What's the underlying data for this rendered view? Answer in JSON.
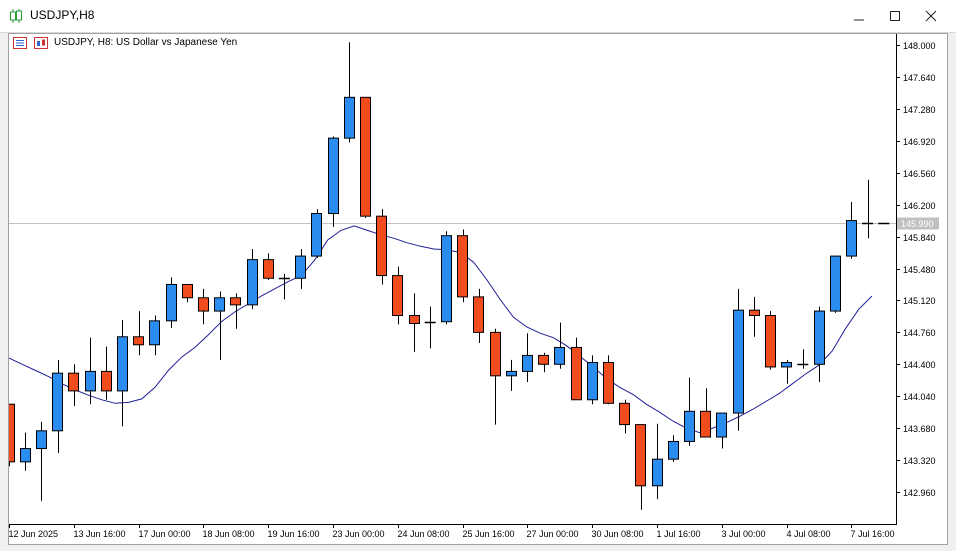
{
  "window": {
    "title": "USDJPY,H8",
    "minimize_icon": "minimize-icon",
    "maximize_icon": "maximize-icon",
    "close_icon": "close-icon"
  },
  "chart_header": {
    "text": "USDJPY, H8:  US Dollar vs Japanese Yen"
  },
  "colors": {
    "bull": "#2b8cf0",
    "bear": "#f04c1e",
    "wick": "#000000",
    "ma": "#1e1e96",
    "grid_line": "#c0c0c0",
    "price_tag_bg": "#c0c0c0"
  },
  "chart_data": {
    "type": "candlestick",
    "symbol": "USDJPY",
    "timeframe": "H8",
    "ylim": [
      142.7,
      148.15
    ],
    "yticks": [
      "148.000",
      "147.640",
      "147.280",
      "146.920",
      "146.560",
      "146.200",
      "145.840",
      "145.480",
      "145.120",
      "144.760",
      "144.400",
      "144.040",
      "143.680",
      "143.320",
      "142.960"
    ],
    "xticks": [
      {
        "label": "12 Jun 2025",
        "index": 0
      },
      {
        "label": "13 Jun 16:00",
        "index": 4
      },
      {
        "label": "17 Jun 00:00",
        "index": 8
      },
      {
        "label": "18 Jun 08:00",
        "index": 12
      },
      {
        "label": "19 Jun 16:00",
        "index": 16
      },
      {
        "label": "23 Jun 00:00",
        "index": 20
      },
      {
        "label": "24 Jun 08:00",
        "index": 24
      },
      {
        "label": "25 Jun 16:00",
        "index": 28
      },
      {
        "label": "27 Jun 00:00",
        "index": 32
      },
      {
        "label": "30 Jun 08:00",
        "index": 36
      },
      {
        "label": "1 Jul 16:00",
        "index": 40
      },
      {
        "label": "3 Jul 00:00",
        "index": 44
      },
      {
        "label": "4 Jul 08:00",
        "index": 48
      },
      {
        "label": "7 Jul 16:00",
        "index": 52
      }
    ],
    "current_price": "145.990",
    "candles": [
      {
        "o": 143.95,
        "h": 143.95,
        "l": 143.25,
        "c": 143.3
      },
      {
        "o": 143.3,
        "h": 143.63,
        "l": 143.2,
        "c": 143.45
      },
      {
        "o": 143.45,
        "h": 143.75,
        "l": 142.86,
        "c": 143.65
      },
      {
        "o": 143.65,
        "h": 144.45,
        "l": 143.4,
        "c": 144.3
      },
      {
        "o": 144.3,
        "h": 144.4,
        "l": 143.93,
        "c": 144.1
      },
      {
        "o": 144.1,
        "h": 144.7,
        "l": 143.95,
        "c": 144.32
      },
      {
        "o": 144.32,
        "h": 144.6,
        "l": 144.0,
        "c": 144.1
      },
      {
        "o": 144.1,
        "h": 144.9,
        "l": 143.7,
        "c": 144.71
      },
      {
        "o": 144.71,
        "h": 145.0,
        "l": 144.5,
        "c": 144.62
      },
      {
        "o": 144.62,
        "h": 144.95,
        "l": 144.5,
        "c": 144.89
      },
      {
        "o": 144.89,
        "h": 145.38,
        "l": 144.81,
        "c": 145.3
      },
      {
        "o": 145.3,
        "h": 145.3,
        "l": 145.1,
        "c": 145.15
      },
      {
        "o": 145.15,
        "h": 145.25,
        "l": 144.85,
        "c": 145.0
      },
      {
        "o": 145.0,
        "h": 145.22,
        "l": 144.45,
        "c": 145.15
      },
      {
        "o": 145.15,
        "h": 145.2,
        "l": 144.8,
        "c": 145.07
      },
      {
        "o": 145.07,
        "h": 145.7,
        "l": 145.02,
        "c": 145.58
      },
      {
        "o": 145.58,
        "h": 145.65,
        "l": 145.35,
        "c": 145.37
      },
      {
        "o": 145.37,
        "h": 145.42,
        "l": 145.13,
        "c": 145.37
      },
      {
        "o": 145.37,
        "h": 145.7,
        "l": 145.25,
        "c": 145.62
      },
      {
        "o": 145.62,
        "h": 146.15,
        "l": 145.6,
        "c": 146.1
      },
      {
        "o": 146.1,
        "h": 146.97,
        "l": 145.95,
        "c": 146.95
      },
      {
        "o": 146.95,
        "h": 148.03,
        "l": 146.9,
        "c": 147.41
      },
      {
        "o": 147.41,
        "h": 147.41,
        "l": 146.05,
        "c": 146.07
      },
      {
        "o": 146.07,
        "h": 146.15,
        "l": 145.3,
        "c": 145.4
      },
      {
        "o": 145.4,
        "h": 145.5,
        "l": 144.85,
        "c": 144.95
      },
      {
        "o": 144.95,
        "h": 145.2,
        "l": 144.54,
        "c": 144.86
      },
      {
        "o": 144.86,
        "h": 145.05,
        "l": 144.58,
        "c": 144.88
      },
      {
        "o": 144.88,
        "h": 145.9,
        "l": 144.85,
        "c": 145.85
      },
      {
        "o": 145.85,
        "h": 145.92,
        "l": 145.1,
        "c": 145.16
      },
      {
        "o": 145.16,
        "h": 145.25,
        "l": 144.64,
        "c": 144.76
      },
      {
        "o": 144.76,
        "h": 144.8,
        "l": 143.72,
        "c": 144.27
      },
      {
        "o": 144.27,
        "h": 144.45,
        "l": 144.1,
        "c": 144.32
      },
      {
        "o": 144.32,
        "h": 144.75,
        "l": 144.2,
        "c": 144.5
      },
      {
        "o": 144.5,
        "h": 144.53,
        "l": 144.31,
        "c": 144.4
      },
      {
        "o": 144.4,
        "h": 144.87,
        "l": 144.35,
        "c": 144.59
      },
      {
        "o": 144.59,
        "h": 144.7,
        "l": 144.0,
        "c": 144.0
      },
      {
        "o": 144.0,
        "h": 144.5,
        "l": 143.95,
        "c": 144.42
      },
      {
        "o": 144.42,
        "h": 144.5,
        "l": 143.95,
        "c": 143.96
      },
      {
        "o": 143.96,
        "h": 144.0,
        "l": 143.62,
        "c": 143.72
      },
      {
        "o": 143.72,
        "h": 143.72,
        "l": 142.76,
        "c": 143.03
      },
      {
        "o": 143.03,
        "h": 143.73,
        "l": 142.88,
        "c": 143.33
      },
      {
        "o": 143.33,
        "h": 143.6,
        "l": 143.3,
        "c": 143.53
      },
      {
        "o": 143.53,
        "h": 144.25,
        "l": 143.48,
        "c": 143.87
      },
      {
        "o": 143.87,
        "h": 144.13,
        "l": 143.58,
        "c": 143.58
      },
      {
        "o": 143.58,
        "h": 143.85,
        "l": 143.45,
        "c": 143.85
      },
      {
        "o": 143.85,
        "h": 145.25,
        "l": 143.65,
        "c": 145.01
      },
      {
        "o": 145.01,
        "h": 145.16,
        "l": 144.71,
        "c": 144.95
      },
      {
        "o": 144.95,
        "h": 145.0,
        "l": 144.34,
        "c": 144.37
      },
      {
        "o": 144.37,
        "h": 144.45,
        "l": 144.18,
        "c": 144.42
      },
      {
        "o": 144.42,
        "h": 144.57,
        "l": 144.35,
        "c": 144.4
      },
      {
        "o": 144.4,
        "h": 145.05,
        "l": 144.2,
        "c": 145.0
      },
      {
        "o": 145.0,
        "h": 145.62,
        "l": 144.98,
        "c": 145.62
      },
      {
        "o": 145.62,
        "h": 146.23,
        "l": 145.59,
        "c": 146.02
      },
      {
        "o": 145.99,
        "h": 146.48,
        "l": 145.82,
        "c": 145.99
      },
      {
        "o": 145.99,
        "h": 145.99,
        "l": 145.99,
        "c": 145.99
      }
    ],
    "moving_average": [
      144.47,
      144.4,
      144.33,
      144.26,
      144.18,
      144.11,
      144.05,
      144.0,
      143.96,
      143.97,
      144.01,
      144.14,
      144.33,
      144.48,
      144.59,
      144.73,
      144.88,
      144.99,
      145.08,
      145.17,
      145.25,
      145.33,
      145.4,
      145.57,
      145.8,
      145.91,
      145.96,
      145.91,
      145.86,
      145.82,
      145.77,
      145.73,
      145.7,
      145.69,
      145.66,
      145.55,
      145.35,
      145.13,
      144.93,
      144.82,
      144.75,
      144.7,
      144.61,
      144.49,
      144.37,
      144.24,
      144.14,
      144.06,
      143.95,
      143.86,
      143.76,
      143.68,
      143.63,
      143.68,
      143.74,
      143.81,
      143.89,
      143.98,
      144.07,
      144.18,
      144.29,
      144.39,
      144.55,
      144.8,
      145.02,
      145.17
    ]
  }
}
